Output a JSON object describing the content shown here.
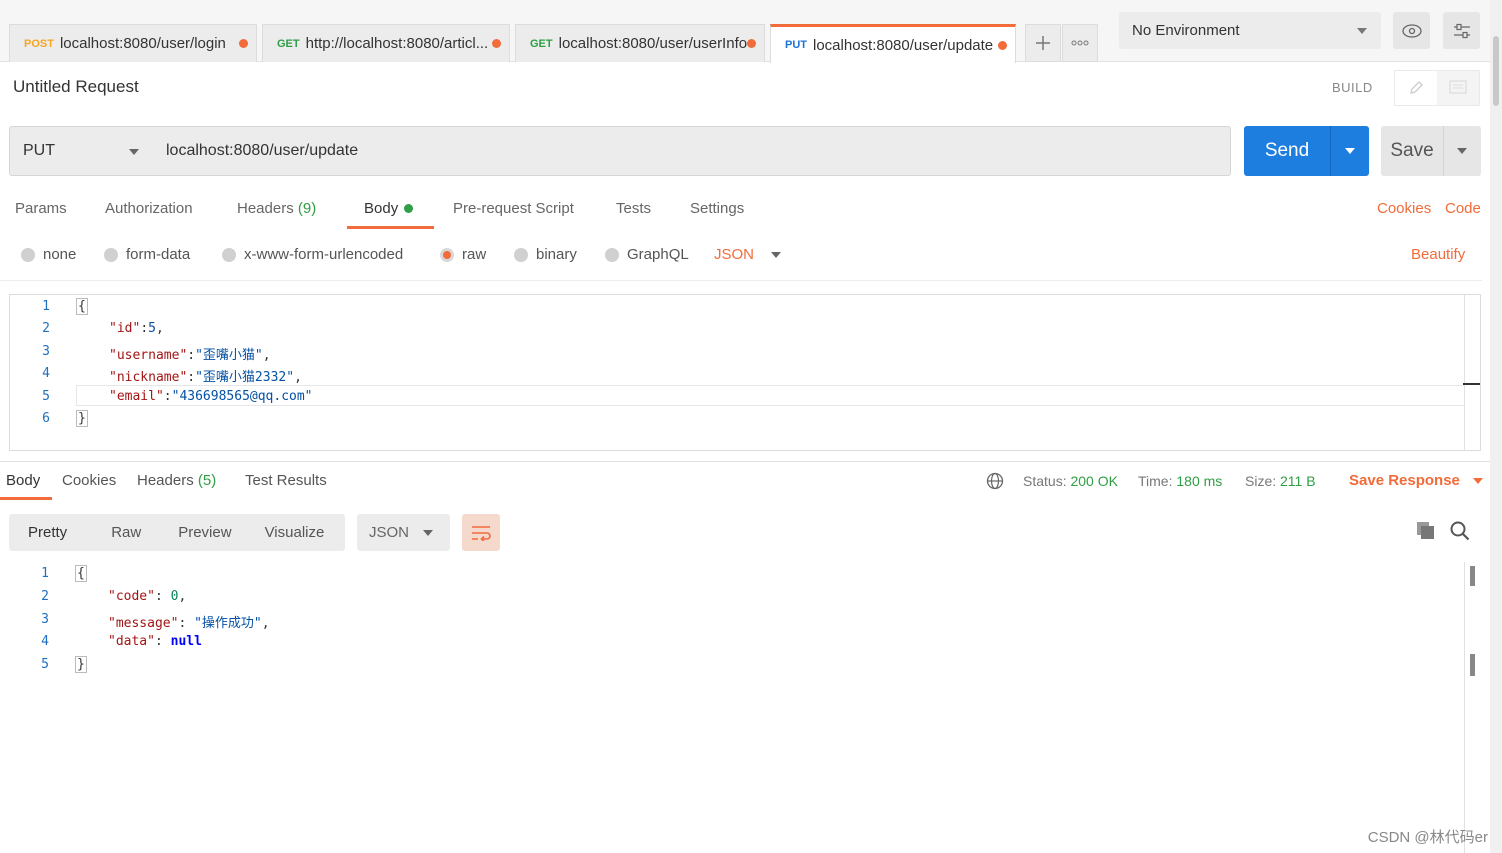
{
  "tabs": [
    {
      "method": "POST",
      "url": "localhost:8080/user/login"
    },
    {
      "method": "GET",
      "url": "http://localhost:8080/articl..."
    },
    {
      "method": "GET",
      "url": "localhost:8080/user/userInfo"
    },
    {
      "method": "PUT",
      "url": "localhost:8080/user/update"
    }
  ],
  "environment": "No Environment",
  "request": {
    "title": "Untitled Request",
    "mode": "BUILD",
    "method": "PUT",
    "url": "localhost:8080/user/update",
    "send_label": "Send",
    "save_label": "Save"
  },
  "request_tabs": {
    "params": "Params",
    "authorization": "Authorization",
    "headers": "Headers",
    "headers_count": "(9)",
    "body": "Body",
    "pre_request": "Pre-request Script",
    "tests": "Tests",
    "settings": "Settings",
    "cookies": "Cookies",
    "code": "Code"
  },
  "body_types": {
    "none": "none",
    "form_data": "form-data",
    "urlencoded": "x-www-form-urlencoded",
    "raw": "raw",
    "binary": "binary",
    "graphql": "GraphQL",
    "format": "JSON",
    "beautify": "Beautify"
  },
  "request_body": {
    "line_numbers": [
      "1",
      "2",
      "3",
      "4",
      "5",
      "6"
    ],
    "open": "{",
    "close": "}",
    "fields": [
      {
        "key": "\"id\"",
        "value": "5",
        "trail": ","
      },
      {
        "key": "\"username\"",
        "value": "\"歪嘴小猫\"",
        "trail": ","
      },
      {
        "key": "\"nickname\"",
        "value": "\"歪嘴小猫2332\"",
        "trail": ","
      },
      {
        "key": "\"email\"",
        "value": "\"436698565@qq.com\"",
        "trail": ""
      }
    ]
  },
  "response_tabs": {
    "body": "Body",
    "cookies": "Cookies",
    "headers": "Headers",
    "headers_count": "(5)",
    "test_results": "Test Results"
  },
  "response_status": {
    "status_label": "Status:",
    "status_value": "200 OK",
    "time_label": "Time:",
    "time_value": "180 ms",
    "size_label": "Size:",
    "size_value": "211 B",
    "save_response": "Save Response"
  },
  "response_view": {
    "pretty": "Pretty",
    "raw": "Raw",
    "preview": "Preview",
    "visualize": "Visualize",
    "format": "JSON"
  },
  "response_body": {
    "line_numbers": [
      "1",
      "2",
      "3",
      "4",
      "5"
    ],
    "open": "{",
    "close": "}",
    "fields": [
      {
        "key": "\"code\"",
        "value": "0",
        "trail": ","
      },
      {
        "key": "\"message\"",
        "value": "\"操作成功\"",
        "trail": ","
      },
      {
        "key": "\"data\"",
        "value": "null",
        "trail": ""
      }
    ]
  },
  "watermark": "CSDN @林代码er",
  "colors": {
    "accent": "#f26b3a",
    "send": "#1e7ee0",
    "success": "#2f9e44"
  }
}
